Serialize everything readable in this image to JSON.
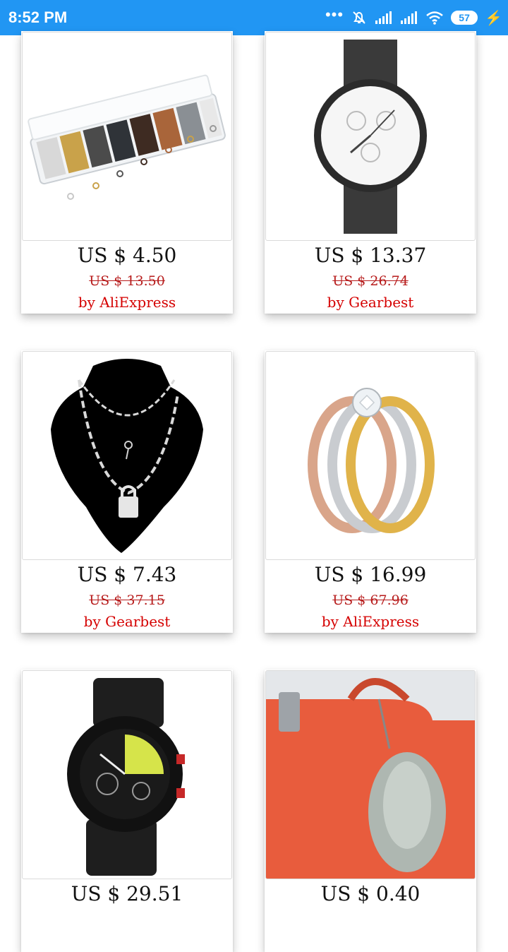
{
  "status_bar": {
    "time": "8:52 PM",
    "battery": "57",
    "icons": [
      "dots-icon",
      "mute-icon",
      "signal-icon",
      "signal-icon",
      "wifi-icon",
      "battery-icon",
      "charging-icon"
    ]
  },
  "products": [
    {
      "image": "jump-rings-box-image",
      "price": "US $ 4.50",
      "old_price": "US $ 13.50",
      "seller": "by AliExpress"
    },
    {
      "image": "mesh-watch-image",
      "price": "US $ 13.37",
      "old_price": "US $ 26.74",
      "seller": "by Gearbest"
    },
    {
      "image": "lock-necklace-image",
      "price": "US $ 7.43",
      "old_price": "US $ 37.15",
      "seller": "by Gearbest"
    },
    {
      "image": "tri-color-ring-image",
      "price": "US $ 16.99",
      "old_price": "US $ 67.96",
      "seller": "by AliExpress"
    },
    {
      "image": "sport-watch-image",
      "price": "US $ 29.51"
    },
    {
      "image": "fur-keychain-bag-image",
      "price": "US $ 0.40"
    }
  ]
}
